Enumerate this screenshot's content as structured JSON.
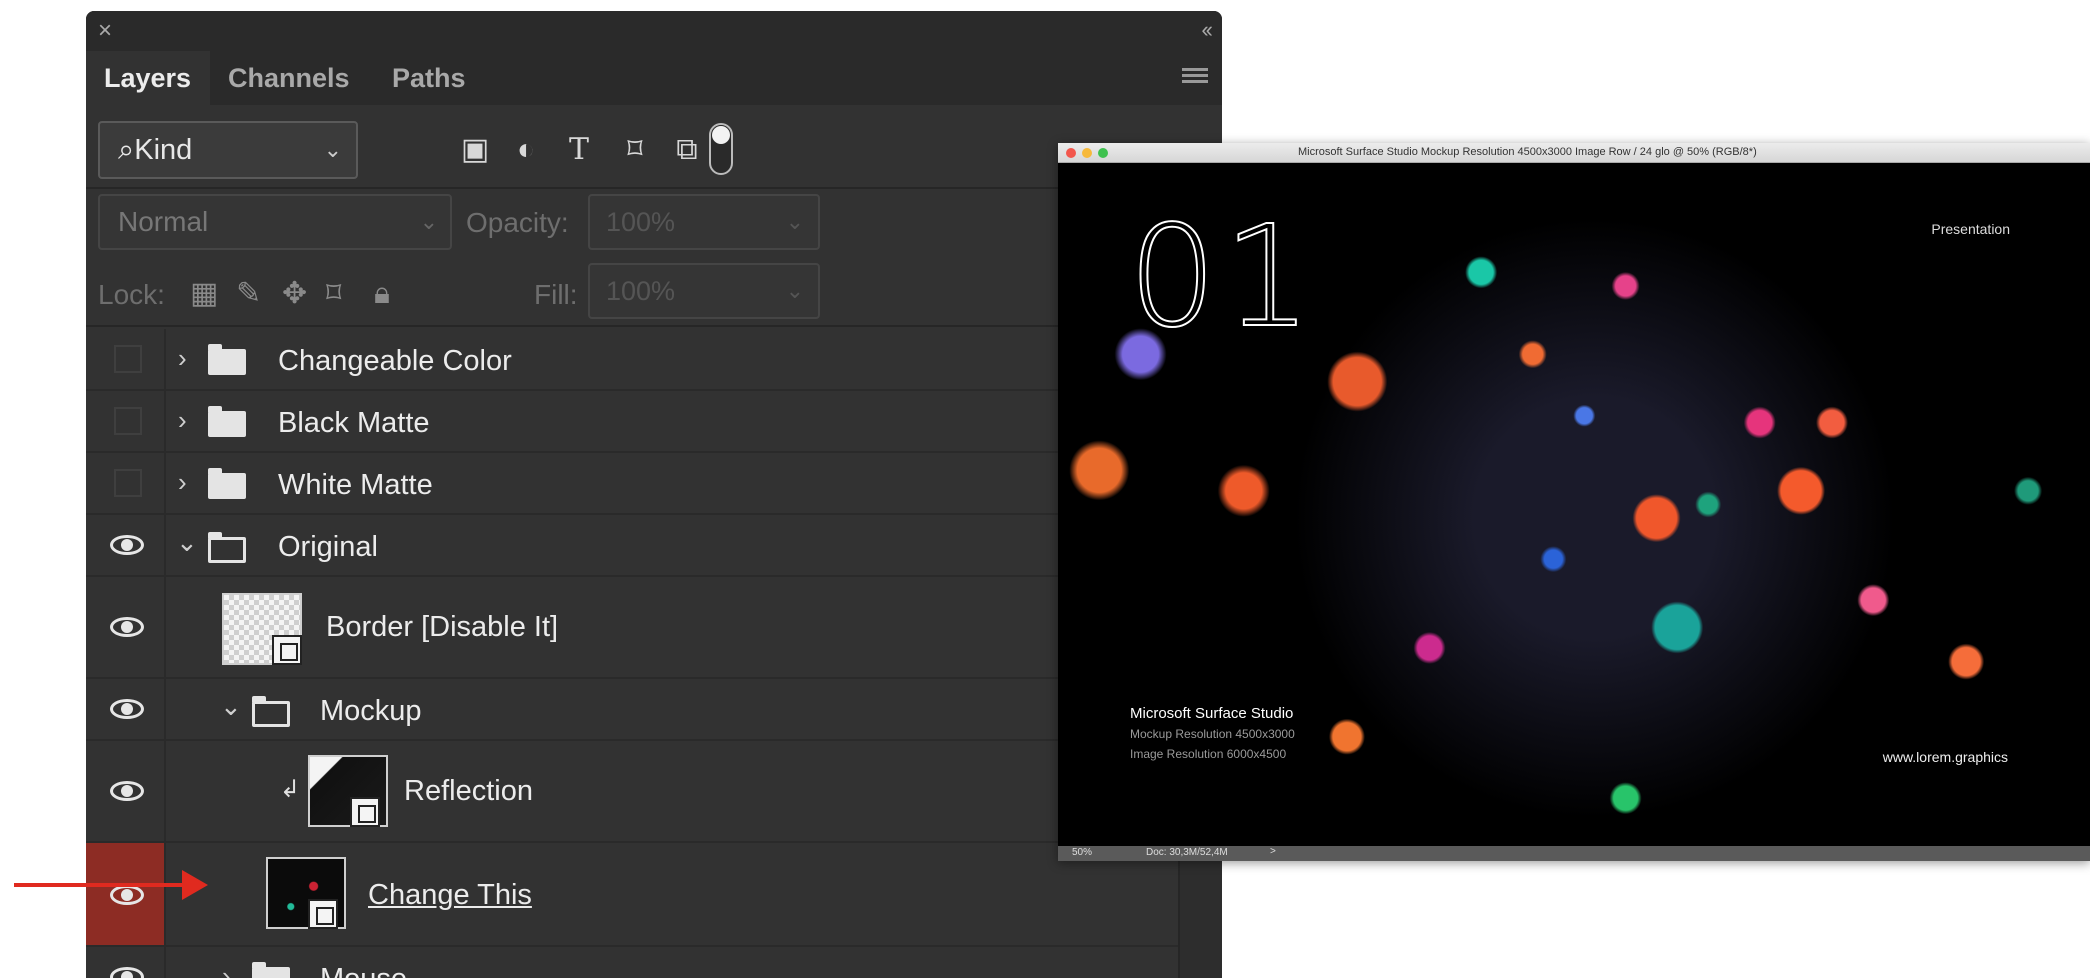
{
  "panel": {
    "close_icon": "×",
    "collapse_icon": "‹‹",
    "tabs": [
      {
        "label": "Layers",
        "active": true
      },
      {
        "label": "Channels",
        "active": false
      },
      {
        "label": "Paths",
        "active": false
      }
    ]
  },
  "filter": {
    "search_icon": "⌕",
    "kind_label": "Kind",
    "chevron": "⌄",
    "icons": [
      "image-filter-icon",
      "adjustment-filter-icon",
      "type-filter-icon",
      "shape-filter-icon",
      "smart-object-filter-icon",
      "filter-toggle-icon"
    ]
  },
  "blend": {
    "mode": "Normal",
    "opacity_label": "Opacity:",
    "opacity_value": "100%"
  },
  "lock": {
    "label": "Lock:",
    "fill_label": "Fill:",
    "fill_value": "100%"
  },
  "layers": [
    {
      "name": "Changeable Color",
      "visible": false,
      "type": "group",
      "expanded": false
    },
    {
      "name": "Black Matte",
      "visible": false,
      "type": "group",
      "expanded": false
    },
    {
      "name": "White Matte",
      "visible": false,
      "type": "group",
      "expanded": false
    },
    {
      "name": "Original",
      "visible": true,
      "type": "group",
      "expanded": true
    },
    {
      "name": "Border [Disable It]",
      "visible": true,
      "type": "shape"
    },
    {
      "name": "Mockup",
      "visible": true,
      "type": "group",
      "expanded": true
    },
    {
      "name": "Reflection",
      "visible": true,
      "type": "smart-object",
      "clipped": true
    },
    {
      "name": "Change This",
      "visible": true,
      "type": "smart-object",
      "highlighted": true
    },
    {
      "name": "Mouse",
      "visible": true,
      "type": "group",
      "expanded": false
    }
  ],
  "preview": {
    "title": "Microsoft Surface Studio Mockup Resolution 4500x3000 Image Row / 24 glo @ 50% (RGB/8*)",
    "slide_number": "01",
    "presented_by": "Presentation",
    "device_title": "Microsoft Surface Studio",
    "mockup_resolution": "Mockup Resolution 4500x3000",
    "image_resolution": "Image Resolution 6000x4500",
    "website": "www.lorem.graphics",
    "status_zoom": "50%",
    "status_doc": "Doc: 30,3M/52,4M",
    "status_arrow": ">"
  },
  "colors": {
    "panel_bg": "#323232",
    "highlight_red": "#8d2c24",
    "arrow_red": "#e02a1f"
  }
}
